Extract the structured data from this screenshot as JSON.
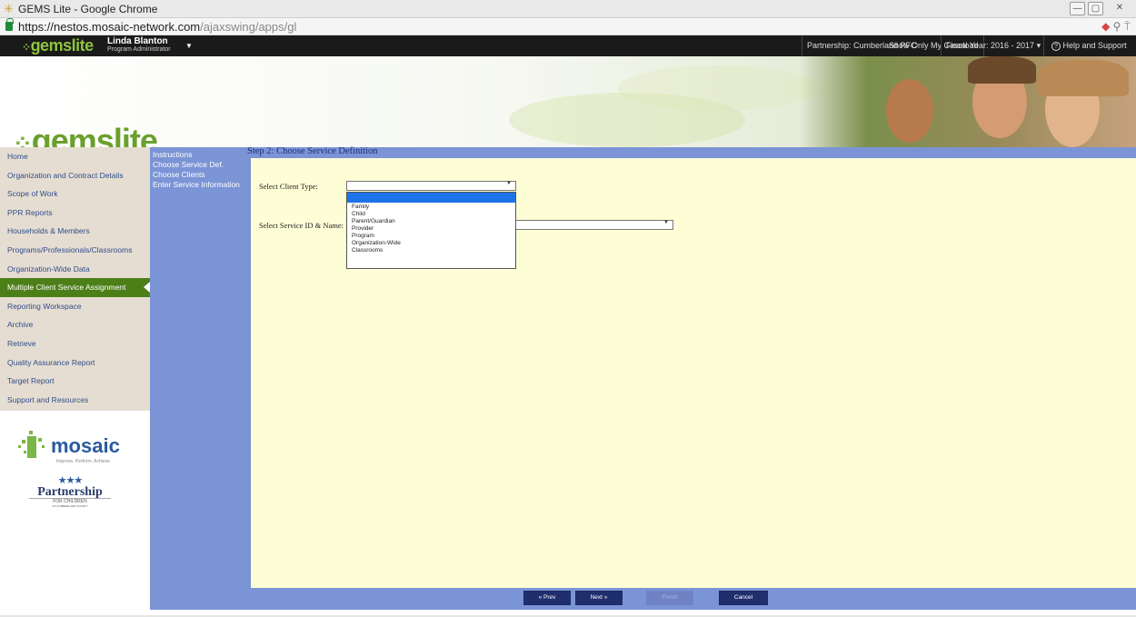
{
  "window": {
    "title": "GEMS Lite - Google Chrome",
    "controls": [
      "—",
      "▢",
      "✕"
    ]
  },
  "address": {
    "host": "https://nestos.mosaic-network.com",
    "path": "/ajaxswing/apps/gl"
  },
  "topbar": {
    "logo": "gemslite",
    "user_name": "Linda Blanton",
    "user_role": "Program Administrator",
    "show_caseload": "Show Only My Caseload",
    "partnership": "Partnership: Cumberland PFC",
    "fiscal_year": "Fiscal Year: 2016 - 2017",
    "help": "Help and Support"
  },
  "banner": {
    "logo": "gemslite"
  },
  "leftnav": {
    "items": [
      "Home",
      "Organization and Contract Details",
      "Scope of Work",
      "PPR Reports",
      "Households & Members",
      "Programs/Professionals/Classrooms",
      "Organization-Wide Data",
      "Multiple Client Service Assignment",
      "Reporting Workspace",
      "Archive",
      "Retrieve",
      "Quality Assurance Report",
      "Target Report",
      "Support and Resources"
    ],
    "active_index": 7
  },
  "logos": {
    "mosaic": "mosaic",
    "mosaic_tagline": "Improve. Perform. Achieve.",
    "partnership": "Partnership",
    "partnership_sub": "FOR CHILDREN",
    "partnership_sub2": "OF CUMBERLAND COUNTY"
  },
  "wizard": {
    "items": [
      "Instructions",
      "Choose Service Def.",
      "Choose Clients",
      "Enter Service Information"
    ]
  },
  "main": {
    "step_title": "Step 2: Choose Service Definition",
    "client_type_label": "Select Client Type:",
    "client_type_value": "",
    "service_label": "Select Service ID & Name:",
    "service_value": "",
    "dropdown_options": [
      "",
      "Family",
      "Child",
      "Parent/Guardian",
      "Provider",
      "Program",
      "Organization-Wide",
      "Classrooms"
    ]
  },
  "buttons": {
    "prev": "« Prev",
    "next": "Next »",
    "finish": "Finish",
    "cancel": "Cancel"
  }
}
